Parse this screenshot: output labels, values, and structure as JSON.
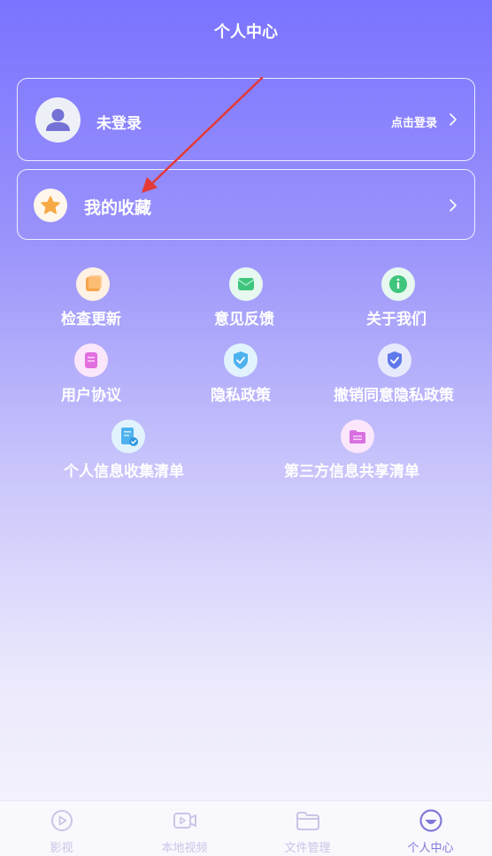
{
  "header": {
    "title": "个人中心"
  },
  "login_card": {
    "name": "未登录",
    "action_label": "点击登录"
  },
  "favorites": {
    "label": "我的收藏"
  },
  "menu": {
    "check_update": "检查更新",
    "feedback": "意见反馈",
    "about": "关于我们",
    "user_agreement": "用户协议",
    "privacy_policy": "隐私政策",
    "revoke_privacy": "撤销同意隐私政策",
    "personal_info_list": "个人信息收集清单",
    "third_party_list": "第三方信息共享清单"
  },
  "tabbar": {
    "tabs": [
      {
        "label": "影视",
        "icon": "play-circle-icon",
        "active": false
      },
      {
        "label": "本地视频",
        "icon": "video-camera-icon",
        "active": false
      },
      {
        "label": "文件管理",
        "icon": "folder-icon",
        "active": false
      },
      {
        "label": "个人中心",
        "icon": "smiley-icon",
        "active": true
      }
    ]
  },
  "colors": {
    "accent": "#7a73ff",
    "tab_active": "#8079d8",
    "tab_inactive": "#c9c6e6",
    "annotation_arrow": "#e53935"
  }
}
